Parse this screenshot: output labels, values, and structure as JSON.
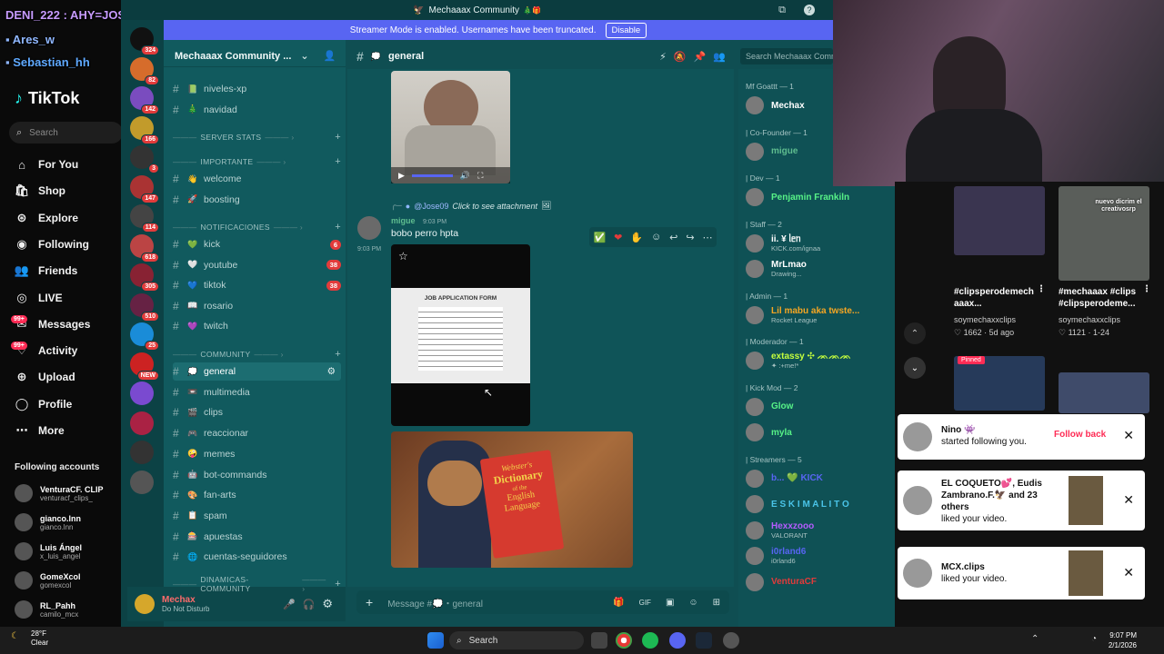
{
  "overlay": {
    "line1": "DENI_222 : AHY=JOSE09",
    "line2": "Ares_w",
    "line3": "Sebastian_hh"
  },
  "tiktok": {
    "logo": "TikTok",
    "search_placeholder": "Search",
    "nav": [
      {
        "label": "For You",
        "icon": "home-icon"
      },
      {
        "label": "Shop",
        "icon": "shop-icon"
      },
      {
        "label": "Explore",
        "icon": "compass-icon"
      },
      {
        "label": "Following",
        "icon": "following-icon"
      },
      {
        "label": "Friends",
        "icon": "friends-icon"
      },
      {
        "label": "LIVE",
        "icon": "live-icon"
      },
      {
        "label": "Messages",
        "icon": "messages-icon",
        "badge": "99+"
      },
      {
        "label": "Activity",
        "icon": "activity-icon",
        "badge": "99+"
      },
      {
        "label": "Upload",
        "icon": "upload-icon"
      },
      {
        "label": "Profile",
        "icon": "profile-icon"
      },
      {
        "label": "More",
        "icon": "more-icon"
      }
    ],
    "following_title": "Following accounts",
    "following": [
      {
        "name": "VenturaCF. CLIP",
        "user": "venturacf_clips_"
      },
      {
        "name": "gianco.lnn",
        "user": "gianco.lnn"
      },
      {
        "name": "Luis Ángel",
        "user": "x_luis_angel"
      },
      {
        "name": "GomeXcol",
        "user": "gomexcol"
      },
      {
        "name": "RL_Pahh",
        "user": "camilo_mcx"
      }
    ]
  },
  "discord": {
    "window_title": "Mechaaax Community",
    "streamer_banner": "Streamer Mode is enabled. Usernames have been truncated.",
    "disable_label": "Disable",
    "server_name": "Mechaaax Community ...",
    "server_badges": [
      "324",
      "82",
      "142",
      "166",
      "3",
      "147",
      "114",
      "618",
      "305",
      "510",
      "25",
      "NEW"
    ],
    "channels": [
      {
        "name": "niveles-xp",
        "emoji": "📗"
      },
      {
        "name": "navidad",
        "emoji": "🎄"
      }
    ],
    "categories": {
      "server_stats": "SERVER STATS",
      "importante": "IMPORTANTE",
      "notificaciones": "NOTIFICACIONES",
      "community": "COMMUNITY",
      "dinamicas": "DINAMICAS-COMMUNITY"
    },
    "importante_channels": [
      {
        "name": "welcome",
        "emoji": "👋"
      },
      {
        "name": "boosting",
        "emoji": "🚀"
      }
    ],
    "notif_channels": [
      {
        "name": "kick",
        "emoji": "💚",
        "badge": "6"
      },
      {
        "name": "youtube",
        "emoji": "🤍",
        "badge": "38"
      },
      {
        "name": "tiktok",
        "emoji": "💙",
        "badge": "38"
      },
      {
        "name": "rosario",
        "emoji": "📖",
        "badge": ""
      },
      {
        "name": "twitch",
        "emoji": "💜",
        "badge": ""
      }
    ],
    "community_channels": [
      {
        "name": "general",
        "emoji": "💭"
      },
      {
        "name": "multimedia",
        "emoji": "📼"
      },
      {
        "name": "clips",
        "emoji": "🎬"
      },
      {
        "name": "reaccionar",
        "emoji": "🎮"
      },
      {
        "name": "memes",
        "emoji": "🤪"
      },
      {
        "name": "bot-commands",
        "emoji": "🤖"
      },
      {
        "name": "fan-arts",
        "emoji": "🎨"
      },
      {
        "name": "spam",
        "emoji": "📋"
      },
      {
        "name": "apuestas",
        "emoji": "🎰"
      },
      {
        "name": "cuentas-seguidores",
        "emoji": "🌐"
      }
    ],
    "user": {
      "name": "Mechax",
      "status": "Do Not Disturb"
    },
    "chat": {
      "channel": "general",
      "search_placeholder": "Search Mechaaax Comm",
      "reply_user": "@Jose09",
      "reply_text": "Click to see attachment",
      "author": "migue",
      "timestamp": "9:03 PM",
      "side_time": "9:03 PM",
      "message": "bobo  perro hpta",
      "form_title": "JOB APPLICATION FORM",
      "book_brand": "Webster's",
      "book_title": "Dictionary",
      "book_sub1": "of the",
      "book_sub2": "English",
      "book_sub3": "Language",
      "input_placeholder": "Message #💭・general"
    },
    "members": [
      {
        "header": "Mf Goattt — 1",
        "items": [
          {
            "name": "Mechax",
            "color": "#ffffff",
            "sub": ""
          }
        ]
      },
      {
        "header": "| Co-Founder — 1",
        "items": [
          {
            "name": "migue",
            "color": "#5fbd8f",
            "sub": ""
          }
        ]
      },
      {
        "header": "| Dev — 1",
        "items": [
          {
            "name": "Penjamin Frankiln",
            "color": "#57f287",
            "sub": ""
          }
        ]
      },
      {
        "header": "| Staff — 2",
        "items": [
          {
            "name": "ii. ¥ ᥣᥱᥒ",
            "color": "#ffffff",
            "sub": "KICK.com/ignaa"
          },
          {
            "name": "MrLmao",
            "color": "#ffffff",
            "sub": "Drawing..."
          }
        ]
      },
      {
        "header": "| Admin — 1",
        "items": [
          {
            "name": "Lil mabu aka twste...",
            "color": "#f5a623",
            "sub": "Rocket League"
          }
        ]
      },
      {
        "header": "| Moderador — 1",
        "items": [
          {
            "name": "extassy ✣ ᨏᨏᨏ",
            "color": "#c6ff3d",
            "sub": "✦ :+me!*"
          }
        ]
      },
      {
        "header": "| Kick Mod — 2",
        "items": [
          {
            "name": "Glow",
            "color": "#57f287",
            "sub": ""
          },
          {
            "name": "myla",
            "color": "#57f287",
            "sub": ""
          }
        ]
      },
      {
        "header": "| Streamers — 5",
        "items": [
          {
            "name": "b... 💚 KICK",
            "color": "#5865f2",
            "sub": ""
          },
          {
            "name": "E S K I M A L I T O",
            "color": "#4ac4e8",
            "sub": ""
          },
          {
            "name": "Hexxzooo",
            "color": "#b45cff",
            "sub": "VALORANT"
          },
          {
            "name": "i0rland6",
            "color": "#5865f2",
            "sub": "i0rland6"
          },
          {
            "name": "VenturaCF",
            "color": "#e23b3b",
            "sub": ""
          }
        ]
      }
    ]
  },
  "tiktok_right": {
    "videos": [
      {
        "title": "#clipsperodemech aaax...",
        "user": "soymechaxxclips",
        "likes": "1662",
        "date": "5d ago",
        "overlay": ""
      },
      {
        "title": "#mechaaax #clips #clipsperodeme...",
        "user": "soymechaxxclips",
        "likes": "1121",
        "date": "1-24",
        "overlay": "nuevo dicrim el creativosrp"
      }
    ],
    "pinned_label": "Pinned",
    "notifications": [
      {
        "name": "Nino 👾",
        "text": "started following you.",
        "action": "Follow back"
      },
      {
        "name": "EL COQUETO💕, Eudis Zambrano.F.🦅 and 23 others",
        "text": "liked your video.",
        "action": ""
      },
      {
        "name": "MCX.clips",
        "text": "liked your video.",
        "action": ""
      }
    ]
  },
  "taskbar": {
    "temp": "28°F",
    "weather": "Clear",
    "search": "Search",
    "time": "9:07 PM",
    "date": "2/1/2026"
  }
}
